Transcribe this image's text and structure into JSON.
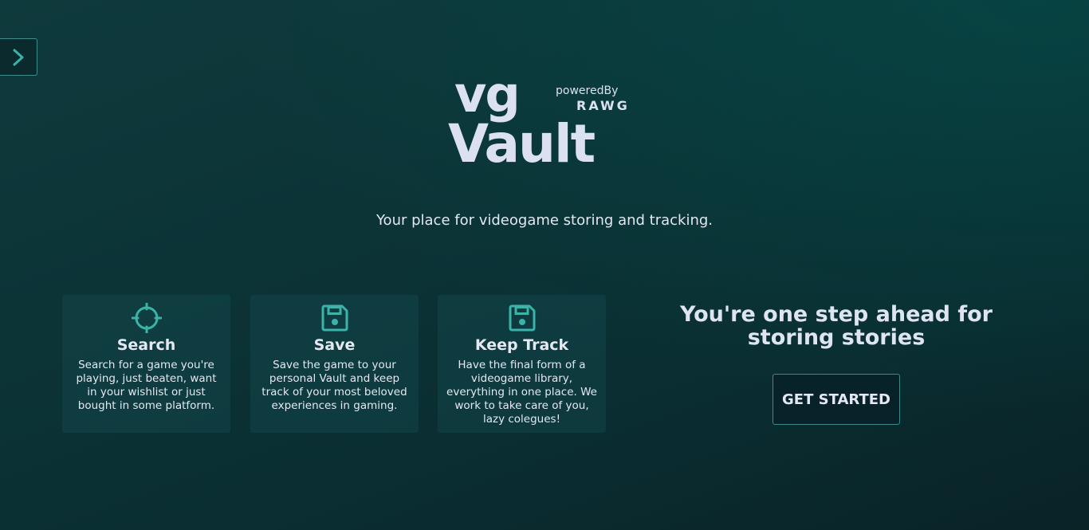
{
  "sidebar": {
    "toggle_icon": "chevron-right-icon"
  },
  "logo": {
    "line1": "vg",
    "line2": "Vault",
    "powered_by": "poweredBy",
    "provider": "RAWG"
  },
  "tagline": "Your place for videogame storing and tracking.",
  "features": [
    {
      "icon": "crosshair-icon",
      "title": "Search",
      "text": "Search for a game you're playing, just beaten, want in your wishlist or just bought in some platform."
    },
    {
      "icon": "save-icon",
      "title": "Save",
      "text": "Save the game to your personal Vault and keep track of your most beloved experiences in gaming."
    },
    {
      "icon": "save-icon",
      "title": "Keep Track",
      "text": "Have the final form of a videogame library, everything in one place. We work to take care of you, lazy colegues!"
    }
  ],
  "cta": {
    "heading": "You're one step ahead for storing stories",
    "button_label": "GET STARTED"
  },
  "colors": {
    "accent": "#3bb3a8",
    "text": "#dfe4f2",
    "background": "#0b2f33"
  }
}
